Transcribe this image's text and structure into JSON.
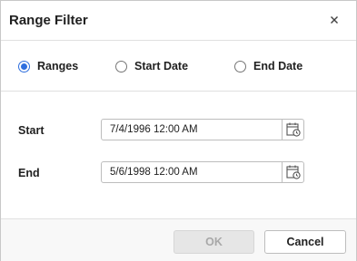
{
  "dialog": {
    "title": "Range Filter",
    "close_icon": "close-icon"
  },
  "options": {
    "selected": "Ranges",
    "items": [
      {
        "label": "Ranges",
        "checked": true
      },
      {
        "label": "Start Date",
        "checked": false
      },
      {
        "label": "End Date",
        "checked": false
      }
    ]
  },
  "fields": {
    "start": {
      "label": "Start",
      "value": "7/4/1996 12:00 AM",
      "icon": "calendar-icon"
    },
    "end": {
      "label": "End",
      "value": "5/6/1998 12:00 AM",
      "icon": "calendar-icon"
    }
  },
  "footer": {
    "ok_label": "OK",
    "ok_enabled": false,
    "cancel_label": "Cancel"
  },
  "colors": {
    "accent": "#2f6fde",
    "disabled_bg": "#e6e6e6",
    "disabled_text": "#a8a8a8"
  }
}
